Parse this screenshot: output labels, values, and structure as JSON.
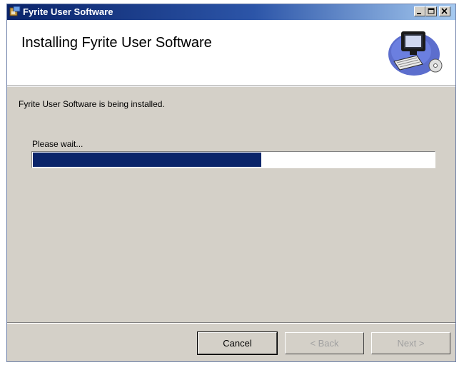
{
  "window": {
    "title": "Fyrite User Software"
  },
  "header": {
    "title": "Installing Fyrite User Software",
    "art_icon": "computer-setup-icon"
  },
  "body": {
    "status_text": "Fyrite User Software is being installed.",
    "wait_label": "Please wait...",
    "progress_fraction": 0.57
  },
  "buttons": {
    "cancel": "Cancel",
    "back": "< Back",
    "next": "Next >"
  },
  "colors": {
    "titlebar_start": "#0a246a",
    "titlebar_end": "#a6caf0",
    "progress_fill": "#0a246a",
    "dialog_bg": "#d4d0c8"
  },
  "icons": [
    "installer-icon",
    "minimize-icon",
    "maximize-icon",
    "close-icon",
    "computer-setup-icon"
  ]
}
